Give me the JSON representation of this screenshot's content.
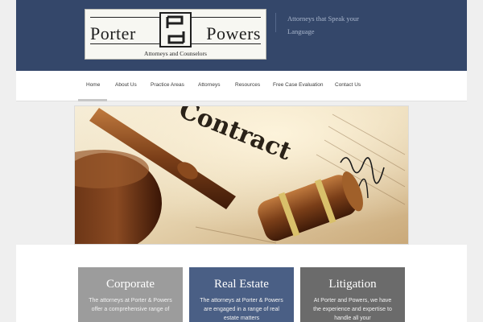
{
  "brand": {
    "name_left": "Porter",
    "name_right": "Powers",
    "subtitle": "Attorneys and Counselors",
    "tagline": "Attorneys that Speak your Language"
  },
  "nav": {
    "items": [
      {
        "label": "Home",
        "active": true
      },
      {
        "label": "About Us"
      },
      {
        "label": "Practice Areas"
      },
      {
        "label": "Attorneys"
      },
      {
        "label": "Resources"
      },
      {
        "label": "Free Case Evaluation"
      },
      {
        "label": "Contact Us"
      }
    ]
  },
  "hero": {
    "contract_word": "Contract"
  },
  "cards": [
    {
      "title": "Corporate",
      "text": "The attorneys at Porter & Powers offer a comprehensive range of",
      "color": "#9c9c9c"
    },
    {
      "title": "Real Estate",
      "text": "The attorneys at Porter & Powers are engaged in a range of real estate matters",
      "color": "#4a5f85"
    },
    {
      "title": "Litigation",
      "text": "At Porter and Powers, we have the experience and expertise to handle all your",
      "color": "#6b6b6b"
    }
  ],
  "colors": {
    "header_bg": "#34476a",
    "page_bg": "#efefef"
  }
}
